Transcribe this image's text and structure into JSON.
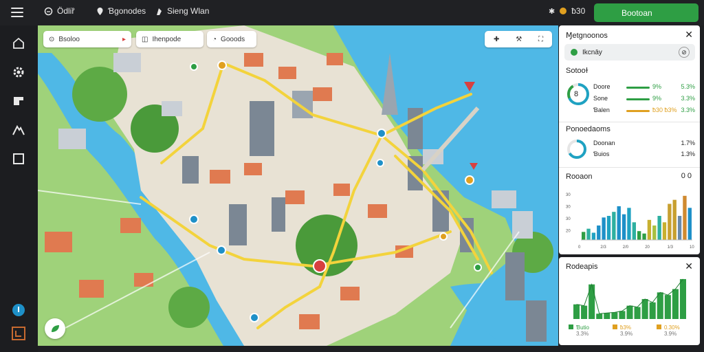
{
  "topbar": {
    "item1": "Ödliȑ",
    "item2": "Ɓgonodes",
    "item3": "Sieng Wlan",
    "status_value": "ƀ30",
    "action_button": "Bootoan"
  },
  "map_toolbar": {
    "pill1": "Bsoloo",
    "pill2": "Ihenpode",
    "pill3": "Gooods"
  },
  "right_panel": {
    "title": "Ɱetgnoonos",
    "search_value": "Ikcnāy",
    "section1_title": "Sotooɫ",
    "ring_label": "8",
    "rows": [
      {
        "label": "Doore",
        "pct": "9%",
        "value": "5.3%",
        "color": "#2e9e44"
      },
      {
        "label": "Sone",
        "pct": "9%",
        "value": "3.3%",
        "color": "#2e9e44"
      },
      {
        "label": "Ɓalen",
        "pct": "ƀ30 ƀ3%",
        "value": "3.3%",
        "color": "#e0a020"
      }
    ],
    "section2_title": "Ponoedaoms",
    "s2_rows": [
      {
        "label": "Doonan",
        "value": "1.7%"
      },
      {
        "label": "Ɓuios",
        "value": "1.3%"
      }
    ],
    "section3_title": "Rooaon",
    "section3_value": "0 0"
  },
  "chart_data": [
    {
      "type": "bar",
      "x_ticks": [
        "0",
        "2/3",
        "2/0",
        "20",
        "1/3",
        "10"
      ],
      "y_ticks": [
        "30",
        "30",
        "30",
        "20"
      ],
      "values": [
        10,
        14,
        9,
        18,
        28,
        30,
        35,
        42,
        32,
        40,
        22,
        11,
        8,
        25,
        18,
        30,
        22,
        45,
        50,
        30,
        55,
        40
      ],
      "colors": [
        "#2e9e44",
        "#2eb0a0",
        "#1fa2c2",
        "#1e90c8",
        "#1e90c8",
        "#1fa2c2",
        "#2eb0a0",
        "#1e90c8",
        "#1e90c8",
        "#1fa2c2",
        "#2eb0a0",
        "#2e9e44",
        "#2e9e44",
        "#c8b030",
        "#a8c040",
        "#2eb0a0",
        "#c8b030",
        "#c8a030",
        "#c8a030",
        "#6a8aaa",
        "#d08a30",
        "#1e90c8"
      ]
    },
    {
      "type": "bar",
      "values": [
        22,
        20,
        52,
        8,
        9,
        10,
        12,
        20,
        18,
        30,
        25,
        40,
        36,
        45,
        60
      ],
      "colors": [
        "#2e9e44",
        "#2e9e44",
        "#2e9e44",
        "#2e9e44",
        "#2e9e44",
        "#2e9e44",
        "#2e9e44",
        "#2e9e44",
        "#2e9e44",
        "#2e9e44",
        "#2e9e44",
        "#2e9e44",
        "#2e9e44",
        "#2e9e44",
        "#2e9e44"
      ],
      "legend": [
        {
          "label": "Ɓutio",
          "sub": "3.3%",
          "color": "#2e9e44"
        },
        {
          "label": "ƀ3%",
          "sub": "3.9%",
          "color": "#e0a020"
        },
        {
          "label": "0.30%",
          "sub": "3.9%",
          "color": "#e0a020"
        }
      ]
    }
  ],
  "bottom_panel": {
    "title": "Rodeapis"
  }
}
